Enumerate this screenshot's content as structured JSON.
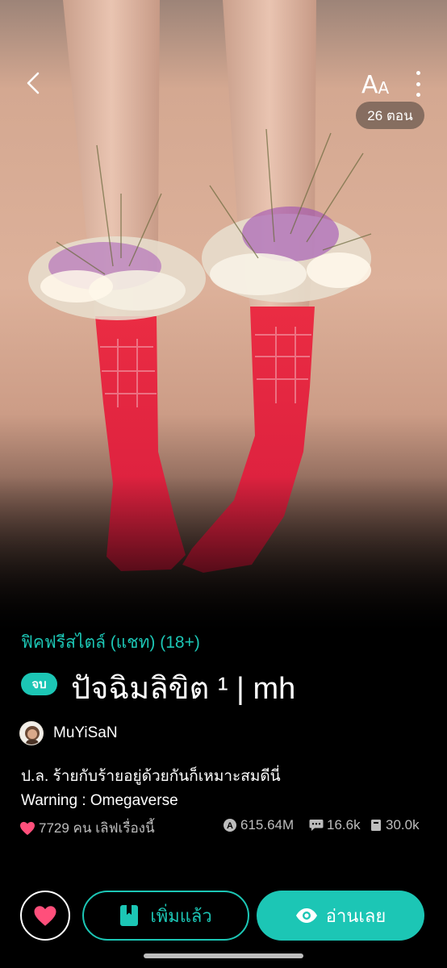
{
  "header": {
    "font_label_big": "A",
    "font_label_small": "A",
    "chapter_count": "26 ตอน"
  },
  "novel": {
    "category": "ฟิคฟรีสไตล์ (แชท) (18+)",
    "status": "จบ",
    "title": "ปัจฉิมลิขิต ¹ | mh",
    "author": "MuYiSaN",
    "description": [
      "ป.ล. ร้ายกับร้ายอยู่ด้วยกันก็เหมาะสมดีนี่",
      "Warning : Omegaverse"
    ],
    "likes": "7729 คน เลิฟเรื่องนี้",
    "views": "615.64M",
    "comments": "16.6k",
    "chapters_read": "30.0k"
  },
  "actions": {
    "added_label": "เพิ่มแล้ว",
    "read_label": "อ่านเลย"
  },
  "colors": {
    "accent": "#1cc6b5",
    "heart": "#ff4f7b",
    "background": "#000000"
  },
  "icons": {
    "back": "chevron-left-icon",
    "more": "more-vertical-icon",
    "heart": "heart-icon",
    "bookmark": "bookmark-icon",
    "eye": "eye-icon",
    "views": "views-icon",
    "comments": "comment-icon",
    "chapters": "book-icon"
  }
}
